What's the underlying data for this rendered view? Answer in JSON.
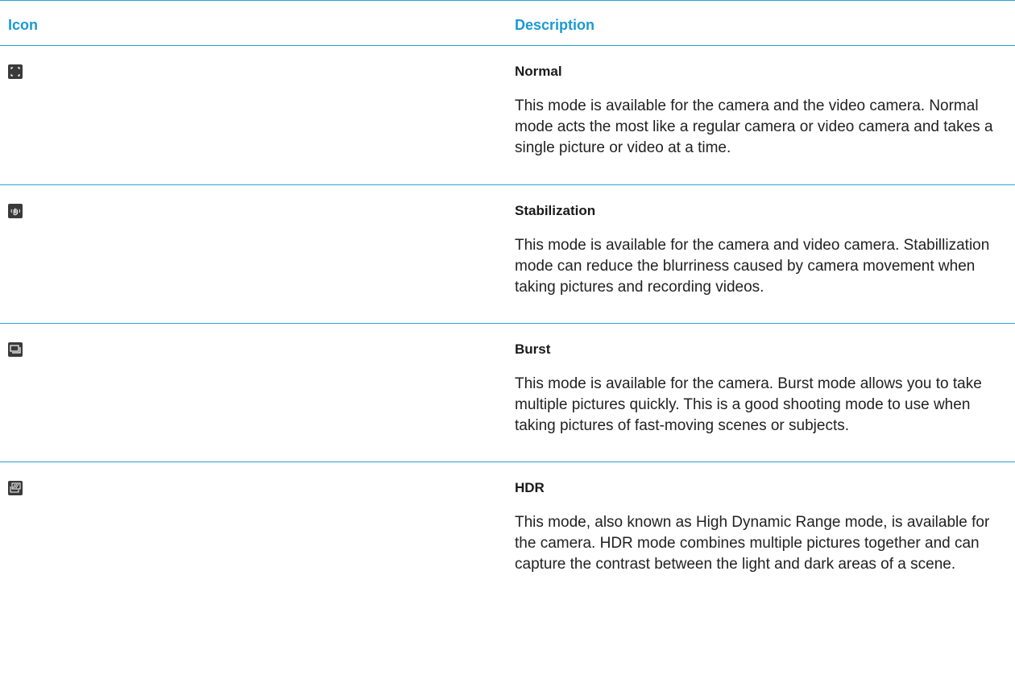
{
  "header": {
    "icon_label": "Icon",
    "description_label": "Description"
  },
  "colors": {
    "accent": "#1a9ad6",
    "rule": "#2aa3d4",
    "icon_bg": "#3a3a3a"
  },
  "rows": [
    {
      "icon": "normal-mode-icon",
      "title": "Normal",
      "text": "This mode is available for the camera and the video camera. Normal mode acts the most like a regular camera or video camera and takes a single picture or video at a time."
    },
    {
      "icon": "stabilization-mode-icon",
      "title": "Stabilization",
      "text": "This mode is available for the camera and video camera. Stabillization mode can reduce the blurriness caused by camera movement when taking pictures and recording videos."
    },
    {
      "icon": "burst-mode-icon",
      "title": "Burst",
      "text": "This mode is available for the camera. Burst mode allows you to take multiple pictures quickly. This is a good shooting mode to use when taking pictures of fast-moving scenes or subjects."
    },
    {
      "icon": "hdr-mode-icon",
      "title": "HDR",
      "text": "This mode, also known as High Dynamic Range mode, is available for the camera. HDR mode combines multiple pictures together and can capture the contrast between the light and dark areas of a scene."
    }
  ]
}
